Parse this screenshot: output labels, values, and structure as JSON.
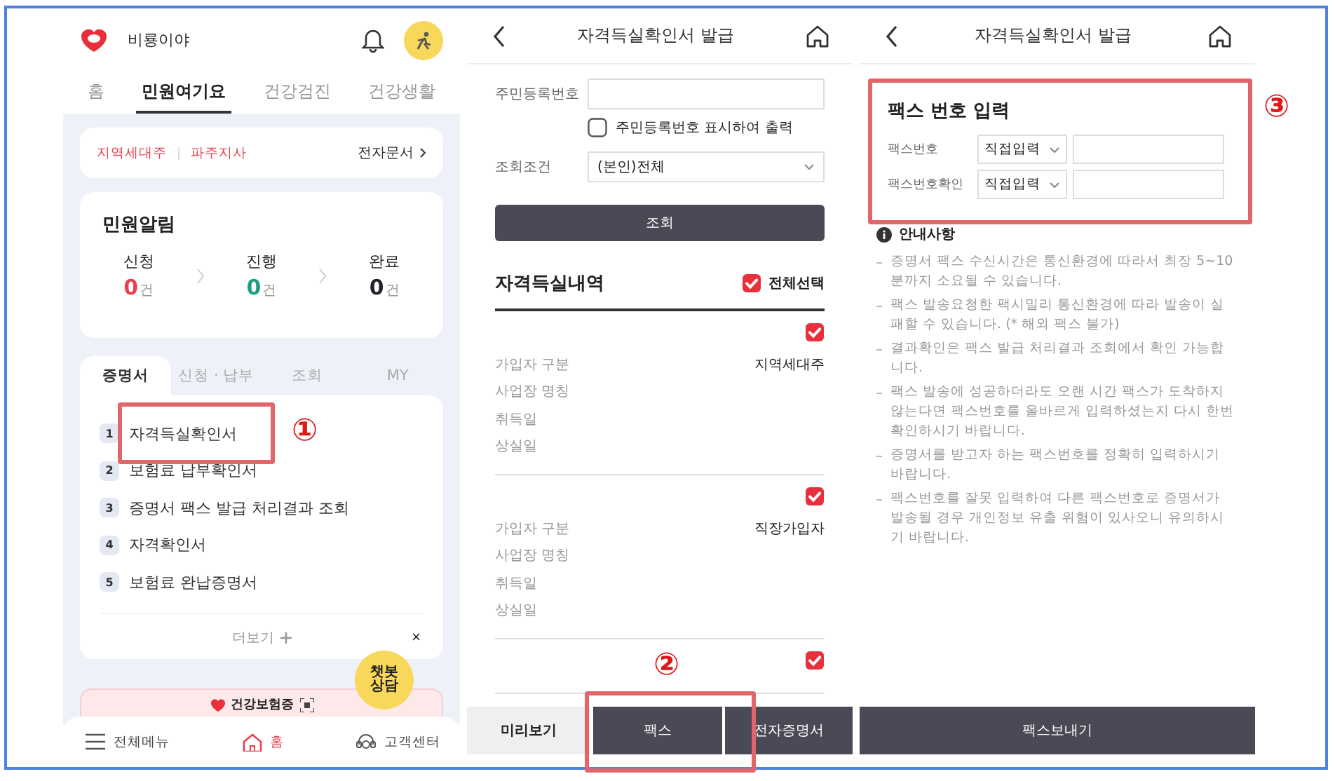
{
  "home_screen": {
    "greeting": "비룡이야",
    "nav_tabs": [
      {
        "label": "홈",
        "selected": false
      },
      {
        "label": "민원여기요",
        "selected": true
      },
      {
        "label": "건강검진",
        "selected": false
      },
      {
        "label": "건강생활",
        "selected": false
      }
    ],
    "office_bar": {
      "region": "지역세대주",
      "branch": "파주지사",
      "link": "전자문서"
    },
    "alerts": {
      "title": "민원알림",
      "steps": [
        {
          "label": "신청",
          "count": "0",
          "unit": "건",
          "color": "#e8414f"
        },
        {
          "label": "진행",
          "count": "0",
          "unit": "건",
          "color": "#1e9e80"
        },
        {
          "label": "완료",
          "count": "0",
          "unit": "건",
          "color": "#23232f"
        }
      ]
    },
    "service_tabs": [
      {
        "label": "증명서",
        "selected": true
      },
      {
        "label": "신청 · 납부",
        "selected": false
      },
      {
        "label": "조회",
        "selected": false
      },
      {
        "label": "MY",
        "selected": false
      }
    ],
    "certificates": [
      {
        "number": "1",
        "label": "자격득실확인서"
      },
      {
        "number": "2",
        "label": "보험료 납부확인서"
      },
      {
        "number": "3",
        "label": "증명서 팩스 발급 처리결과 조회"
      },
      {
        "number": "4",
        "label": "자격확인서"
      },
      {
        "number": "5",
        "label": "보험료 완납증명서"
      }
    ],
    "more": "더보기",
    "chatbot": {
      "lines": [
        "챗봇",
        "상담"
      ],
      "close": "×"
    },
    "banner": "건강보험증",
    "bottom_nav": [
      {
        "label": "전체메뉴",
        "kind": "menu",
        "selected": false
      },
      {
        "label": "홈",
        "kind": "home",
        "selected": true
      },
      {
        "label": "고객센터",
        "kind": "support",
        "selected": false
      }
    ]
  },
  "issue_screen": {
    "title": "자격득실확인서 발급",
    "id_label": "주민등록번호",
    "show_id": {
      "label": "주민등록번호 표시하여 출력",
      "checked": false
    },
    "condition_label": "조회조건",
    "condition_value": "(본인)전체",
    "search_button": "조회",
    "section_title": "자격득실내역",
    "select_all": {
      "label": "전체선택",
      "checked": true
    },
    "records": [
      {
        "checked": true,
        "fields": [
          {
            "label": "가입자 구분",
            "value": "지역세대주"
          },
          {
            "label": "사업장 명칭"
          },
          {
            "label": "취득일"
          },
          {
            "label": "상실일"
          }
        ]
      },
      {
        "checked": true,
        "fields": [
          {
            "label": "가입자 구분",
            "value": "직장가입자"
          },
          {
            "label": "사업장 명칭"
          },
          {
            "label": "취득일"
          },
          {
            "label": "상실일"
          }
        ]
      },
      {
        "checked": true
      }
    ],
    "buttons": [
      {
        "label": "미리보기",
        "kind": "light"
      },
      {
        "label": "팩스",
        "kind": "dark"
      },
      {
        "label": "전자증명서",
        "kind": "dark"
      }
    ]
  },
  "fax_screen": {
    "title": "자격득실확인서 발급",
    "heading": "팩스 번호 입력",
    "rows": [
      {
        "label": "팩스번호",
        "select": "직접입력"
      },
      {
        "label": "팩스번호확인",
        "select": "직접입력"
      }
    ],
    "notice_title": "안내사항",
    "notices": [
      "증명서 팩스 수신시간은 통신환경에 따라서 최장 5~10분까지 소요될 수 있습니다.",
      "팩스 발송요청한 팩시밀리 통신환경에 따라 발송이 실패할 수 있습니다. (* 해외 팩스 불가)",
      "결과확인은 팩스 발급 처리결과 조회에서 확인 가능합니다.",
      "팩스 발송에 성공하더라도 오랜 시간 팩스가 도착하지 않는다면 팩스번호를 올바르게 입력하셨는지 다시 한번 확인하시기 바랍니다.",
      "증명서를 받고자 하는 팩스번호를 정확히 입력하시기 바랍니다.",
      "팩스번호를 잘못 입력하여 다른 팩스번호로 증명서가 발송될 경우 개인정보 유출 위험이 있사오니 유의하시기 바랍니다."
    ],
    "send_button": "팩스보내기"
  },
  "annotations": [
    {
      "number": "①"
    },
    {
      "number": "②"
    },
    {
      "number": "③"
    }
  ]
}
